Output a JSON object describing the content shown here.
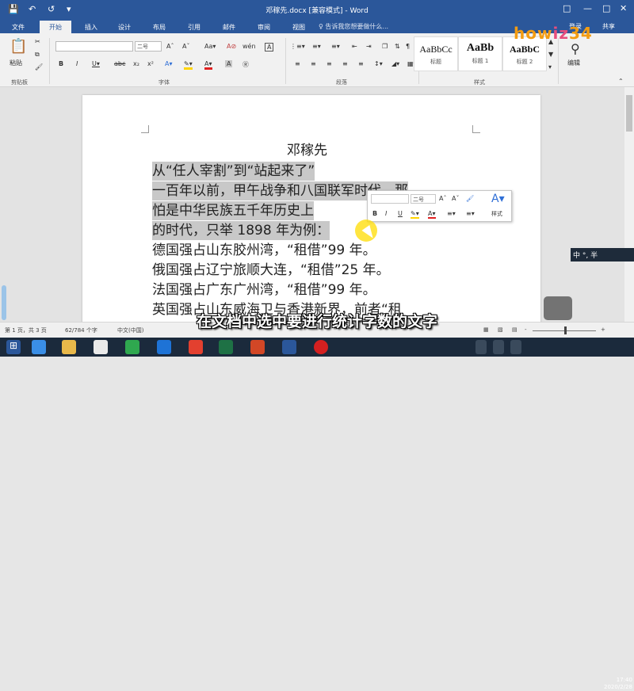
{
  "titlebar": {
    "title": "邓稼先.docx [兼容模式] - Word",
    "save_icon": "save-icon",
    "undo_icon": "undo-icon",
    "redo_icon": "redo-icon"
  },
  "tabs": [
    "文件",
    "开始",
    "插入",
    "设计",
    "布局",
    "引用",
    "邮件",
    "审阅",
    "视图"
  ],
  "active_tab": "开始",
  "tellme": "♀ 告诉我您想要做什么...",
  "login": "登录",
  "share": "共享",
  "ribbon": {
    "paste": "粘贴",
    "clipboard": "剪贴板",
    "font_group": "字体",
    "paragraph_group": "段落",
    "styles_group": "样式",
    "editing": "编辑",
    "font_size": "二号",
    "styles": [
      {
        "sample": "AaBbCc",
        "label": "标题"
      },
      {
        "sample": "AaBb",
        "label": "标题 1"
      },
      {
        "sample": "AaBbC",
        "label": "标题 2"
      }
    ]
  },
  "document": {
    "title": "邓稼先",
    "lines": [
      "从“任人宰割”到“站起来了”",
      "一百年以前，甲午战争和八国联军时代，那",
      "怕是中华民族五千年历史上",
      "的时代，只举 1898 年为例：",
      "德国强占山东胶州湾，“租借”99 年。",
      "俄国强占辽宁旅顺大连，“租借”25 年。",
      "法国强占广东广州湾，“租借”99 年。",
      "英国强占山东威海卫与香港新界，前者“租"
    ]
  },
  "mini_toolbar": {
    "font_size": "二号",
    "styles": "样式"
  },
  "subtitle": "在文档中选中要进行统计字数的文字",
  "statusbar": {
    "page": "第 1 页，共 3 页",
    "words": "62/784 个字",
    "lang": "中文(中国)",
    "zoom_minus": "-",
    "zoom_plus": "+"
  },
  "ime": "中 °, 半",
  "watermark": "howiz34",
  "clock": {
    "time": "17:40",
    "date": "2020/2/28"
  },
  "colors": {
    "word_blue": "#2b579a",
    "highlight_yellow": "#ffd400",
    "font_red": "#e02020"
  }
}
